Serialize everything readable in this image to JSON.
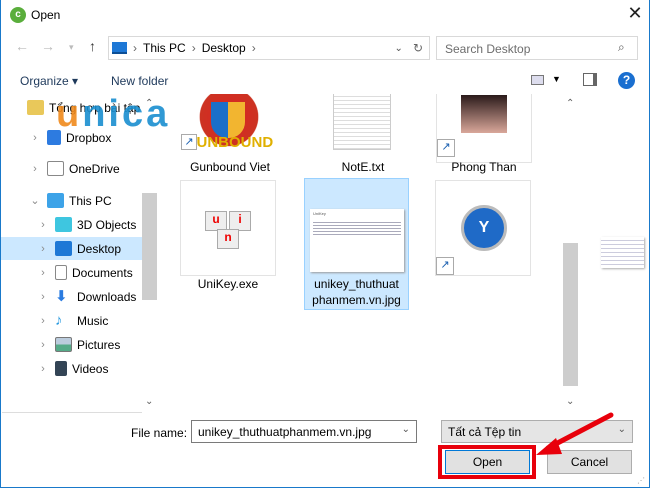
{
  "window": {
    "title": "Open",
    "close_icon": "close-icon"
  },
  "address": {
    "path": [
      "This PC",
      "Desktop"
    ]
  },
  "search": {
    "placeholder": "Search Desktop"
  },
  "toolbar": {
    "organize": "Organize ▾",
    "new_folder": "New folder"
  },
  "nav": {
    "items": [
      {
        "label": "Tổng hợp bài tập",
        "icon": "folder-icon"
      },
      {
        "label": "Dropbox",
        "icon": "dropbox-icon"
      },
      {
        "label": "OneDrive",
        "icon": "onedrive-icon"
      },
      {
        "label": "This PC",
        "icon": "computer-icon"
      },
      {
        "label": "3D Objects",
        "icon": "cube-icon"
      },
      {
        "label": "Desktop",
        "icon": "desktop-icon"
      },
      {
        "label": "Documents",
        "icon": "document-icon"
      },
      {
        "label": "Downloads",
        "icon": "download-icon"
      },
      {
        "label": "Music",
        "icon": "music-icon"
      },
      {
        "label": "Pictures",
        "icon": "pictures-icon"
      },
      {
        "label": "Videos",
        "icon": "videos-icon"
      }
    ]
  },
  "files": [
    {
      "name": "Gunbound Viet"
    },
    {
      "name": "NotE.txt"
    },
    {
      "name": "Phong Than"
    },
    {
      "name": "UniKey.exe"
    },
    {
      "name": "unikey_thuthuat phanmem.vn.jpg",
      "line1": "unikey_thuthuat",
      "line2": "phanmem.vn.jpg"
    },
    {
      "name": ""
    }
  ],
  "preview_thumb_text": "UniKey",
  "watermark": "unica",
  "footer": {
    "file_name_label": "File name:",
    "file_name_value": "unikey_thuthuatphanmem.vn.jpg",
    "filter": "Tất cả Tệp tin",
    "open": "Open",
    "cancel": "Cancel"
  },
  "colors": {
    "accent": "#1979ca",
    "selection": "#cce8ff",
    "highlight": "#e8000b"
  }
}
